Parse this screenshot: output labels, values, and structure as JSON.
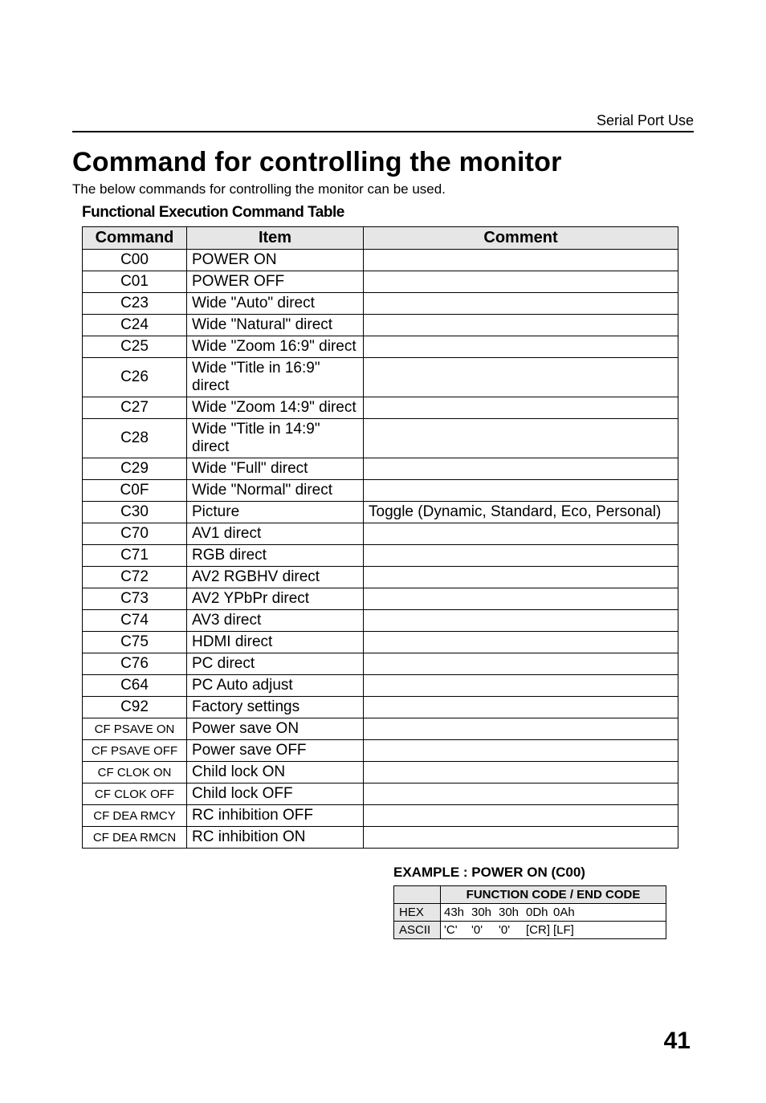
{
  "header": {
    "section": "Serial Port Use"
  },
  "title": "Command for controlling the monitor",
  "intro": "The below commands for controlling the monitor can be used.",
  "subheader": "Functional Execution Command Table",
  "table": {
    "headers": {
      "command": "Command",
      "item": "Item",
      "comment": "Comment"
    },
    "rows": [
      {
        "cmd": "C00",
        "small": false,
        "item": "POWER ON",
        "comment": ""
      },
      {
        "cmd": "C01",
        "small": false,
        "item": "POWER OFF",
        "comment": ""
      },
      {
        "cmd": "C23",
        "small": false,
        "item": "Wide \"Auto\" direct",
        "comment": ""
      },
      {
        "cmd": "C24",
        "small": false,
        "item": "Wide \"Natural\" direct",
        "comment": ""
      },
      {
        "cmd": "C25",
        "small": false,
        "item": "Wide \"Zoom 16:9\" direct",
        "comment": ""
      },
      {
        "cmd": "C26",
        "small": false,
        "item": "Wide \"Title in 16:9\" direct",
        "comment": ""
      },
      {
        "cmd": "C27",
        "small": false,
        "item": "Wide \"Zoom 14:9\" direct",
        "comment": ""
      },
      {
        "cmd": "C28",
        "small": false,
        "item": "Wide \"Title in 14:9\" direct",
        "comment": ""
      },
      {
        "cmd": "C29",
        "small": false,
        "item": "Wide \"Full\" direct",
        "comment": ""
      },
      {
        "cmd": "C0F",
        "small": false,
        "item": "Wide \"Normal\" direct",
        "comment": ""
      },
      {
        "cmd": "C30",
        "small": false,
        "item": "Picture",
        "comment": "Toggle (Dynamic, Standard, Eco, Personal)"
      },
      {
        "cmd": "C70",
        "small": false,
        "item": "AV1 direct",
        "comment": ""
      },
      {
        "cmd": "C71",
        "small": false,
        "item": "RGB direct",
        "comment": ""
      },
      {
        "cmd": "C72",
        "small": false,
        "item": "AV2 RGBHV  direct",
        "comment": ""
      },
      {
        "cmd": "C73",
        "small": false,
        "item": "AV2 YPbPr direct",
        "comment": ""
      },
      {
        "cmd": "C74",
        "small": false,
        "item": "AV3 direct",
        "comment": ""
      },
      {
        "cmd": "C75",
        "small": false,
        "item": "HDMI direct",
        "comment": ""
      },
      {
        "cmd": "C76",
        "small": false,
        "item": "PC direct",
        "comment": ""
      },
      {
        "cmd": "C64",
        "small": false,
        "item": "PC Auto adjust",
        "comment": ""
      },
      {
        "cmd": "C92",
        "small": false,
        "item": "Factory settings",
        "comment": ""
      },
      {
        "cmd": "CF PSAVE ON",
        "small": true,
        "item": "Power save ON",
        "comment": ""
      },
      {
        "cmd": "CF PSAVE OFF",
        "small": true,
        "item": "Power save OFF",
        "comment": ""
      },
      {
        "cmd": "CF CLOK ON",
        "small": true,
        "item": "Child lock ON",
        "comment": ""
      },
      {
        "cmd": "CF CLOK OFF",
        "small": true,
        "item": "Child lock OFF",
        "comment": ""
      },
      {
        "cmd": "CF DEA RMCY",
        "small": true,
        "item": "RC inhibition OFF",
        "comment": ""
      },
      {
        "cmd": "CF DEA RMCN",
        "small": true,
        "item": "RC inhibition ON",
        "comment": ""
      }
    ]
  },
  "example": {
    "title": "EXAMPLE : POWER ON (C00)",
    "header": "FUNCTION CODE / END CODE",
    "rows": [
      {
        "label": "HEX",
        "codes": [
          "43h",
          "30h",
          "30h",
          "0Dh",
          "0Ah"
        ]
      },
      {
        "label": "ASCII",
        "codes": [
          "'C'",
          "'0'",
          "'0'",
          "[CR]",
          "[LF]"
        ]
      }
    ]
  },
  "pageNumber": "41"
}
